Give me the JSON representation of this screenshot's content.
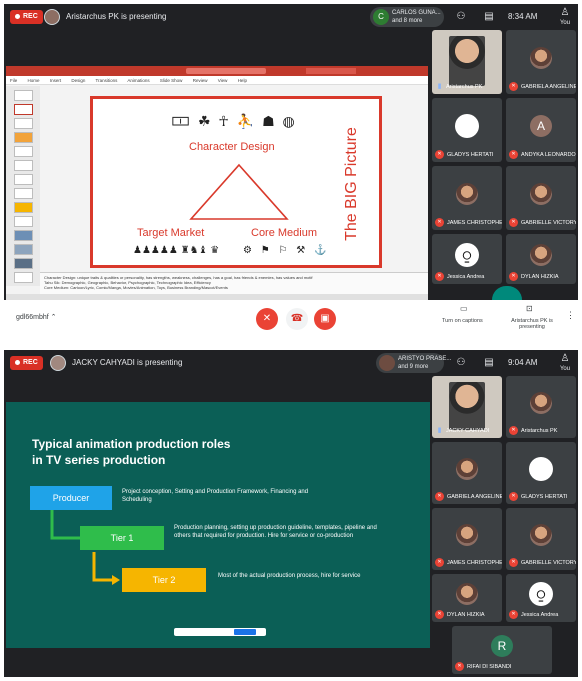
{
  "colors": {
    "meet_bg": "#202124",
    "tile_bg": "#3c4043",
    "rec_red": "#d93025",
    "mic_off": "#ea4335",
    "slide1_border": "#d9392b",
    "slide2_bg": "#0b5f56",
    "producer_box": "#1fa3e8",
    "tier1_box": "#2fbd4b",
    "tier2_box": "#f6b500",
    "ppt_ribbon": "#c0392b"
  },
  "screen1": {
    "recording_label": "REC",
    "presenting_text": "Aristarchus PK is presenting",
    "presenter_chip": {
      "initial": "C",
      "name": "CARLOS GUNA...",
      "more": "and 8 more"
    },
    "time": "8:34 AM",
    "you_label": "You",
    "powerpoint": {
      "ribbon_tabs": [
        "File",
        "Home",
        "Insert",
        "Design",
        "Transitions",
        "Animations",
        "Slide Show",
        "Review",
        "View",
        "Help"
      ],
      "slide_count": 14,
      "slide": {
        "side_title": "The BIG Picture",
        "character_design": "Character Design",
        "target_market": "Target Market",
        "core_medium": "Core Medium",
        "icons_top": "🀱 ☘ ☥ ⛹ ☗ ◍",
        "icons_left": "♟♟♟♟♟ ♜♞♝ ♛",
        "icons_right": "⚙ ⚑ ⚐ ⚒ ⚓"
      },
      "notes": [
        "Character Design: unique traits & qualities or personality, has strengths, weakness, challenges, has a goal, has friends & enemies, has values and motif",
        "Tahu Sik: Demographic, Geographic, Behavior, Psychographic, Technographic Idea, Efficiency",
        "Core Medium: Cartoon/Lyric, Comic/Manga, Movies/Animation, Toys, Business Branding/Mascot/Events"
      ]
    },
    "participants": [
      {
        "name": "Aristarchus PK",
        "mic": "on",
        "kind": "photo"
      },
      {
        "name": "GABRIELA ANGELINE",
        "mic": "off",
        "kind": "photo"
      },
      {
        "name": "GLADYS HERTATI",
        "mic": "off",
        "kind": "white"
      },
      {
        "name": "ANDYKA LEONARDO",
        "mic": "off",
        "initial": "A",
        "kind": "initial",
        "color": "#8d6e63"
      },
      {
        "name": "JAMES CHRISTOPHER",
        "mic": "off",
        "kind": "photo"
      },
      {
        "name": "GABRIELLE VICTORY",
        "mic": "off",
        "kind": "photo"
      },
      {
        "name": "Jessica Andrea",
        "mic": "off",
        "kind": "logo"
      },
      {
        "name": "DYLAN HIZKIA",
        "mic": "off",
        "kind": "photo"
      }
    ],
    "bottom": {
      "meeting_code": "gdl66mbhf",
      "captions_label": "Turn on captions",
      "presenting_label": "Aristarchus PK is presenting"
    }
  },
  "screen2": {
    "recording_label": "REC",
    "presenting_text": "JACKY CAHYADI is presenting",
    "presenter_chip": {
      "name": "ARISTYO PRASE...",
      "more": "and 9 more"
    },
    "time": "9:04 AM",
    "you_label": "You",
    "slide": {
      "title_line1": "Typical animation production roles",
      "title_line2": "in TV series production",
      "producer": {
        "label": "Producer",
        "desc": "Project conception, Setting and Production Framework, Financing and Scheduling"
      },
      "tier1": {
        "label": "Tier 1",
        "desc": "Production planning, setting up production guideline, templates, pipeline and others that required for production. Hire for service or co-production"
      },
      "tier2": {
        "label": "Tier 2",
        "desc": "Most of the actual production process, hire for service"
      }
    },
    "participants": [
      {
        "name": "JACKY CAHYADI",
        "mic": "on",
        "kind": "photo"
      },
      {
        "name": "Aristarchus PK",
        "mic": "off",
        "kind": "photo"
      },
      {
        "name": "GABRIELA ANGELINE",
        "mic": "off",
        "kind": "photo"
      },
      {
        "name": "GLADYS HERTATI",
        "mic": "off",
        "kind": "white"
      },
      {
        "name": "JAMES CHRISTOPHER",
        "mic": "off",
        "kind": "photo"
      },
      {
        "name": "GABRIELLE VICTORY",
        "mic": "off",
        "kind": "photo"
      },
      {
        "name": "DYLAN HIZKIA",
        "mic": "off",
        "kind": "photo"
      },
      {
        "name": "Jessica Andrea",
        "mic": "off",
        "kind": "logo"
      },
      {
        "name": "RIFAI DI SIBANDI",
        "mic": "off",
        "initial": "R",
        "kind": "initial",
        "color": "#2e7d5b"
      }
    ]
  }
}
